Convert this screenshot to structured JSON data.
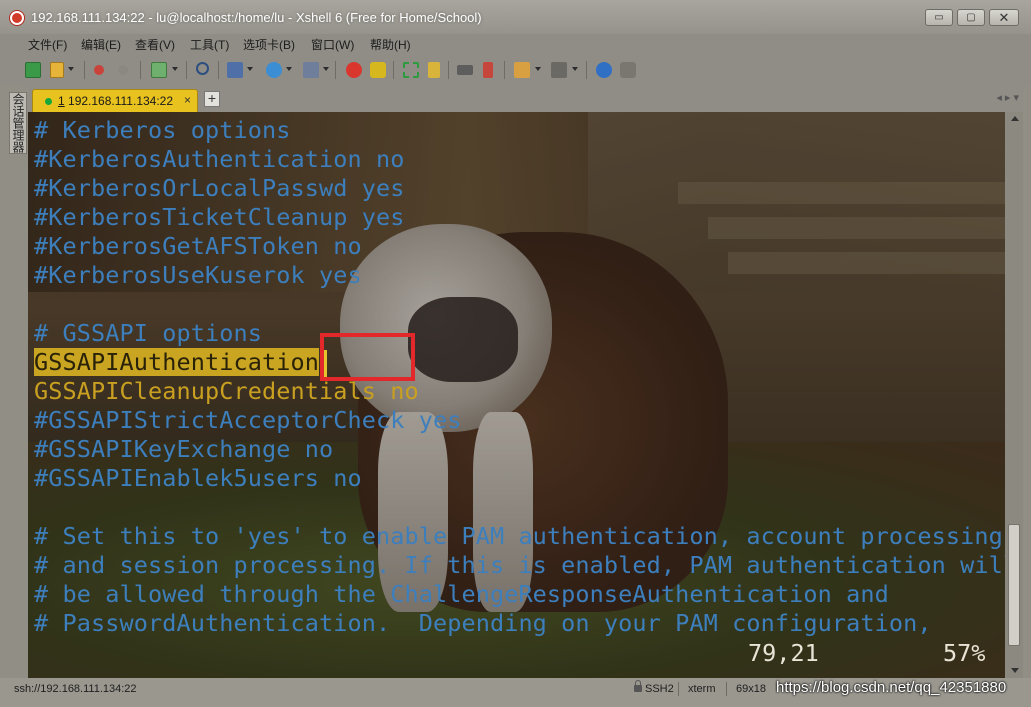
{
  "window": {
    "title": "192.168.111.134:22 - lu@localhost:/home/lu - Xshell 6 (Free for Home/School)",
    "buttons": {
      "minimize": "▭",
      "maximize": "▢",
      "close": "✕"
    }
  },
  "menu": [
    {
      "label": "文件(F)"
    },
    {
      "label": "编辑(E)"
    },
    {
      "label": "查看(V)"
    },
    {
      "label": "工具(T)"
    },
    {
      "label": "选项卡(B)"
    },
    {
      "label": "窗口(W)"
    },
    {
      "label": "帮助(H)"
    }
  ],
  "sidebar": {
    "session_manager_label": "会话管理器"
  },
  "tabs": {
    "active": {
      "number": "1",
      "label": "192.168.111.134:22",
      "close": "×"
    },
    "add": "+",
    "nav": "◂ ▸ ▾"
  },
  "terminal": {
    "lines": [
      "# Kerberos options",
      "#KerberosAuthentication no",
      "#KerberosOrLocalPasswd yes",
      "#KerberosTicketCleanup yes",
      "#KerberosGetAFSToken no",
      "#KerberosUseKuserok yes",
      "",
      "# GSSAPI options",
      "",
      "GSSAPICleanupCredentials no",
      "#GSSAPIStrictAcceptorCheck yes",
      "#GSSAPIKeyExchange no",
      "#GSSAPIEnablek5users no",
      "",
      "# Set this to 'yes' to enable PAM authentication, account processing,",
      "# and session processing. If this is enabled, PAM authentication will",
      "# be allowed through the ChallengeResponseAuthentication and",
      "# PasswordAuthentication.  Depending on your PAM configuration,"
    ],
    "highlighted_line": "GSSAPIAuthentication",
    "cursor_position": "79,21",
    "scroll_percent": "57%",
    "colors": {
      "comment": "#3d7fbd",
      "active_text": "#c9a020",
      "highlight_bg": "#c9a522",
      "annotation_box": "#e3282b"
    }
  },
  "statusbar": {
    "connection": "ssh://192.168.111.134:22",
    "protocol": "SSH2",
    "terminal_type": "xterm",
    "size": "69x18",
    "watermark": "https://blog.csdn.net/qq_42351880"
  },
  "icons": [
    "new-session-icon",
    "open-folder-icon",
    "connect-icon",
    "disconnect-icon",
    "reconnect-icon",
    "find-icon",
    "properties-icon",
    "globe-icon",
    "font-icon",
    "xshell-icon",
    "xftp-icon",
    "fullscreen-icon",
    "lock-icon",
    "keyboard-icon",
    "script-icon",
    "new-folder-icon",
    "layout-icon",
    "help-icon",
    "chat-icon"
  ]
}
